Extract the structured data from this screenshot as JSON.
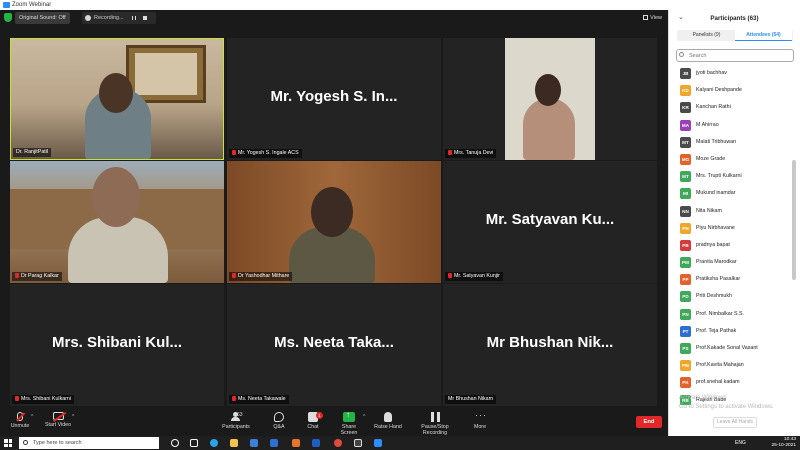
{
  "window": {
    "title": "Zoom Webinar"
  },
  "topbar": {
    "original_sound": "Original Sound: Off",
    "recording": "Recording...",
    "view": "View"
  },
  "tiles": [
    {
      "label": "Dr. RanjitPatil",
      "big_name": "",
      "muted": false,
      "active": true
    },
    {
      "label": "Mr. Yogesh S. Ingale ACS",
      "big_name": "Mr. Yogesh S. In...",
      "muted": true,
      "active": false
    },
    {
      "label": "Mrs. Tanuja Devi",
      "big_name": "",
      "muted": true,
      "active": false
    },
    {
      "label": "Dr Parag Kalkar",
      "big_name": "",
      "muted": true,
      "active": false
    },
    {
      "label": "Dr Yashodhar Mithare",
      "big_name": "",
      "muted": true,
      "active": false
    },
    {
      "label": "Mr. Satyavan Kunjir",
      "big_name": "Mr. Satyavan Ku...",
      "muted": true,
      "active": false
    },
    {
      "label": "Mrs. Shibani Kulkarni",
      "big_name": "Mrs. Shibani Kul...",
      "muted": true,
      "active": false
    },
    {
      "label": "Ms. Neeta Takawale",
      "big_name": "Ms. Neeta Taka...",
      "muted": true,
      "active": false
    },
    {
      "label": "Mr Bhushan Nikam",
      "big_name": "Mr Bhushan Nik...",
      "muted": false,
      "active": false
    }
  ],
  "toolbar": {
    "unmute": "Unmute",
    "start_video": "Start Video",
    "participants": "Participants",
    "participants_count": "63",
    "qa": "Q&A",
    "chat": "Chat",
    "chat_badge": "1",
    "share_screen": "Share Screen",
    "raise_hand": "Raise Hand",
    "pause_recording": "Pause/Stop Recording",
    "more": "More",
    "end": "End"
  },
  "panel": {
    "title": "Participants (63)",
    "tab_panelists": "Panelists (9)",
    "tab_attendees": "Attendees (54)",
    "search_placeholder": "Search",
    "attendees": [
      {
        "initials": "JB",
        "name": "jyoti bachhav",
        "color": "#4a4a4a"
      },
      {
        "initials": "KD",
        "name": "Kalyani Deshpande",
        "color": "#f0a52b"
      },
      {
        "initials": "KR",
        "name": "Kanchan Rathi",
        "color": "#4a4a4a"
      },
      {
        "initials": "MA",
        "name": "M Ahirrao",
        "color": "#9b3fb5"
      },
      {
        "initials": "MT",
        "name": "Malati Tribhuwan",
        "color": "#4a4a4a"
      },
      {
        "initials": "MG",
        "name": "Moze Grade",
        "color": "#e2622a"
      },
      {
        "initials": "MT",
        "name": "Mrs. Trupti Kulkarni",
        "color": "#3fa85a"
      },
      {
        "initials": "MI",
        "name": "Mukund inamdar",
        "color": "#3fa85a"
      },
      {
        "initials": "NN",
        "name": "Nita Nikam",
        "color": "#4a4a4a"
      },
      {
        "initials": "PN",
        "name": "Piyu Nirbhavane",
        "color": "#f0a52b"
      },
      {
        "initials": "PB",
        "name": "pradnya bapat",
        "color": "#d33c3c"
      },
      {
        "initials": "PM",
        "name": "Pranita Marodkar",
        "color": "#3fa85a"
      },
      {
        "initials": "PP",
        "name": "Pratiksha Pasalkar",
        "color": "#e2622a"
      },
      {
        "initials": "PD",
        "name": "Priti Deshmukh",
        "color": "#3fa85a"
      },
      {
        "initials": "PN",
        "name": "Prof. Nimbalkar S.S.",
        "color": "#3fa85a"
      },
      {
        "initials": "PT",
        "name": "Prof. Teja Pathak",
        "color": "#2d6fd0"
      },
      {
        "initials": "PS",
        "name": "Prof.Kakade Sonal Vasant",
        "color": "#3fa85a"
      },
      {
        "initials": "PM",
        "name": "Prof.Kavita Mahajan",
        "color": "#f0a52b"
      },
      {
        "initials": "PK",
        "name": "prof.snehal kadam",
        "color": "#e2622a"
      },
      {
        "initials": "RB",
        "name": "Rajesh Bade",
        "color": "#3fa85a"
      }
    ],
    "watermark_line1": "Activate Windows",
    "watermark_line2": "Go to Settings to activate Windows.",
    "leave_button": "Leave All Hands"
  },
  "taskbar": {
    "search_placeholder": "Type here to search",
    "language": "ENG",
    "time": "10:43",
    "date": "25-10-2021"
  },
  "colors": {
    "accent": "#2d8cff",
    "active_speaker": "#c8e23a",
    "end_red": "#e02828",
    "share_green": "#24b345"
  }
}
